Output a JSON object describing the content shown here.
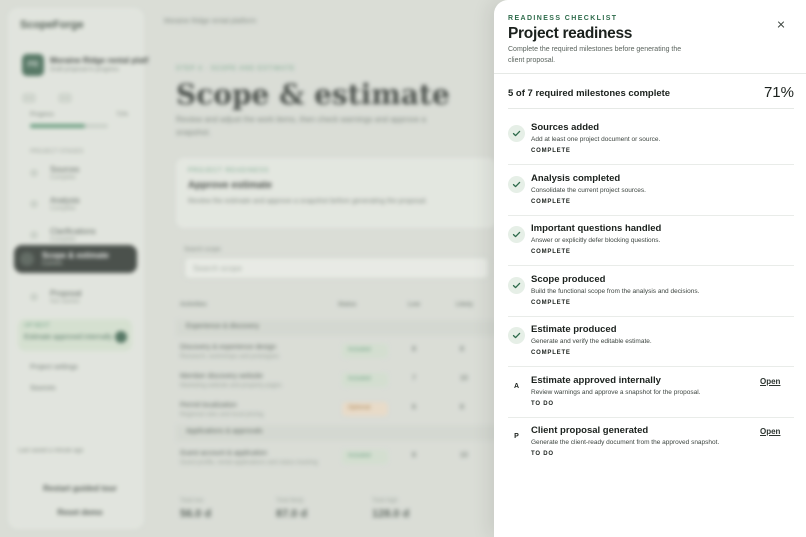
{
  "background": {
    "brand": "ScopeForge",
    "project": {
      "name": "Moraine Ridge rental platf",
      "sub": "Draft proposal in progress",
      "initials": "PR"
    },
    "progress": {
      "label": "Progress",
      "value": "71%",
      "fraction": 0.71
    },
    "sidebar_section": "PROJECT STAGES",
    "stages": [
      {
        "title": "Sources",
        "sub": "Complete"
      },
      {
        "title": "Analysis",
        "sub": "Complete"
      },
      {
        "title": "Clarifications",
        "sub": "Complete"
      }
    ],
    "active_stage": {
      "title": "Scope & estimate",
      "sub": "Current"
    },
    "stage_after": {
      "title": "Proposal",
      "sub": "Not started"
    },
    "next_card": {
      "title": "UP NEXT",
      "sub": "Estimate approved internally"
    },
    "links": [
      "Project settings",
      "Sources"
    ],
    "note": "Last saved a minute ago",
    "buttons": [
      "Restart guided tour",
      "Reset demo"
    ],
    "crumb": "Moraine Ridge rental platform",
    "step": "STEP 4 · SCOPE AND ESTIMATE",
    "heading": "Scope & estimate",
    "lead": "Review and adjust the work items, then check warnings and approve a snapshot.",
    "ready_card": {
      "kicker": "PROJECT READINESS",
      "title": "Approve estimate",
      "sub": "Review the estimate and approve a snapshot before generating the proposal."
    },
    "search": {
      "label": "Search scope",
      "placeholder": "Search scope"
    },
    "table_head": [
      "Activities",
      "Status",
      "Low",
      "Likely"
    ],
    "groups": [
      "Experience & discovery",
      "Applications & approvals"
    ],
    "rows": [
      {
        "title": "Discovery & experience design",
        "sub": "Research, workshops and prototypes",
        "badge": "Included",
        "low": "8",
        "likely": "8"
      },
      {
        "title": "Member discovery website",
        "sub": "Marketing website and property pages",
        "badge": "Included",
        "low": "7",
        "likely": "10"
      },
      {
        "title": "Permit localization",
        "sub": "Regional rules and local pricing",
        "badge": "Optional",
        "low": "6",
        "likely": "8"
      },
      {
        "title": "Guest account & application",
        "sub": "Guest profile, rental applications and status tracking",
        "badge": "Included",
        "low": "8",
        "likely": "10"
      }
    ],
    "totals": [
      {
        "label": "Total low",
        "value": "56.0 d"
      },
      {
        "label": "Total likely",
        "value": "87.0 d"
      },
      {
        "label": "Total high",
        "value": "128.0 d"
      }
    ]
  },
  "drawer": {
    "eyebrow": "READINESS CHECKLIST",
    "title": "Project readiness",
    "subtitle": "Complete the required milestones before generating the client proposal.",
    "summary": "5 of 7 required milestones complete",
    "percent": "71%",
    "open_label": "Open",
    "items": [
      {
        "title": "Sources added",
        "desc": "Add at least one project document or source.",
        "status": "COMPLETE",
        "done": true,
        "marker": ""
      },
      {
        "title": "Analysis completed",
        "desc": "Consolidate the current project sources.",
        "status": "COMPLETE",
        "done": true,
        "marker": ""
      },
      {
        "title": "Important questions handled",
        "desc": "Answer or explicitly defer blocking questions.",
        "status": "COMPLETE",
        "done": true,
        "marker": ""
      },
      {
        "title": "Scope produced",
        "desc": "Build the functional scope from the analysis and decisions.",
        "status": "COMPLETE",
        "done": true,
        "marker": ""
      },
      {
        "title": "Estimate produced",
        "desc": "Generate and verify the editable estimate.",
        "status": "COMPLETE",
        "done": true,
        "marker": ""
      },
      {
        "title": "Estimate approved internally",
        "desc": "Review warnings and approve a snapshot for the proposal.",
        "status": "TO DO",
        "done": false,
        "marker": "A"
      },
      {
        "title": "Client proposal generated",
        "desc": "Generate the client-ready document from the approved snapshot.",
        "status": "TO DO",
        "done": false,
        "marker": "P"
      }
    ]
  }
}
